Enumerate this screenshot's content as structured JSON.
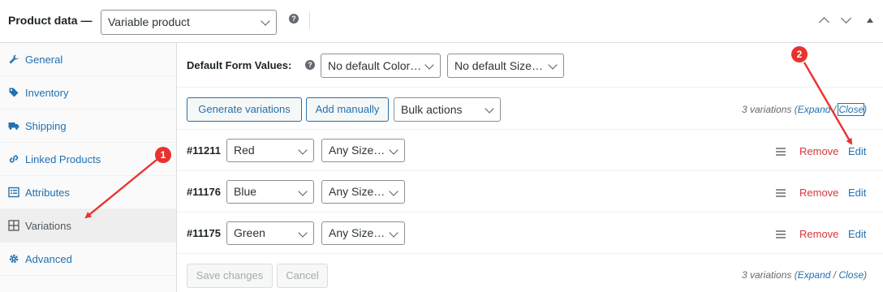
{
  "header": {
    "title": "Product data —",
    "product_type_value": "Variable product",
    "help_glyph": "?"
  },
  "sidebar": {
    "items": [
      {
        "label": "General",
        "icon": "wrench-icon"
      },
      {
        "label": "Inventory",
        "icon": "tag-icon"
      },
      {
        "label": "Shipping",
        "icon": "truck-icon"
      },
      {
        "label": "Linked Products",
        "icon": "link-icon"
      },
      {
        "label": "Attributes",
        "icon": "list-icon"
      },
      {
        "label": "Variations",
        "icon": "grid-icon",
        "active": true
      },
      {
        "label": "Advanced",
        "icon": "gear-icon"
      }
    ]
  },
  "defaults": {
    "label": "Default Form Values:",
    "color_value": "No default Color…",
    "size_value": "No default Size…"
  },
  "toolbar": {
    "generate_label": "Generate variations",
    "add_label": "Add manually",
    "bulk_value": "Bulk actions",
    "count_text": "3 variations",
    "expand_label": "Expand",
    "sep": "/",
    "close_label": "Close"
  },
  "variations": [
    {
      "id": "#11211",
      "color": "Red",
      "size": "Any Size…",
      "remove": "Remove",
      "edit": "Edit"
    },
    {
      "id": "#11176",
      "color": "Blue",
      "size": "Any Size…",
      "remove": "Remove",
      "edit": "Edit"
    },
    {
      "id": "#11175",
      "color": "Green",
      "size": "Any Size…",
      "remove": "Remove",
      "edit": "Edit"
    }
  ],
  "footer": {
    "save_label": "Save changes",
    "cancel_label": "Cancel",
    "count_text": "3 variations",
    "expand_label": "Expand",
    "sep": "/",
    "close_label": "Close"
  },
  "annotations": {
    "badge_1": "1",
    "badge_2": "2",
    "color": "#e8322e"
  },
  "colors": {
    "link": "#2271b1",
    "remove": "#d63638",
    "active_tab_bg": "#eeeeee"
  }
}
